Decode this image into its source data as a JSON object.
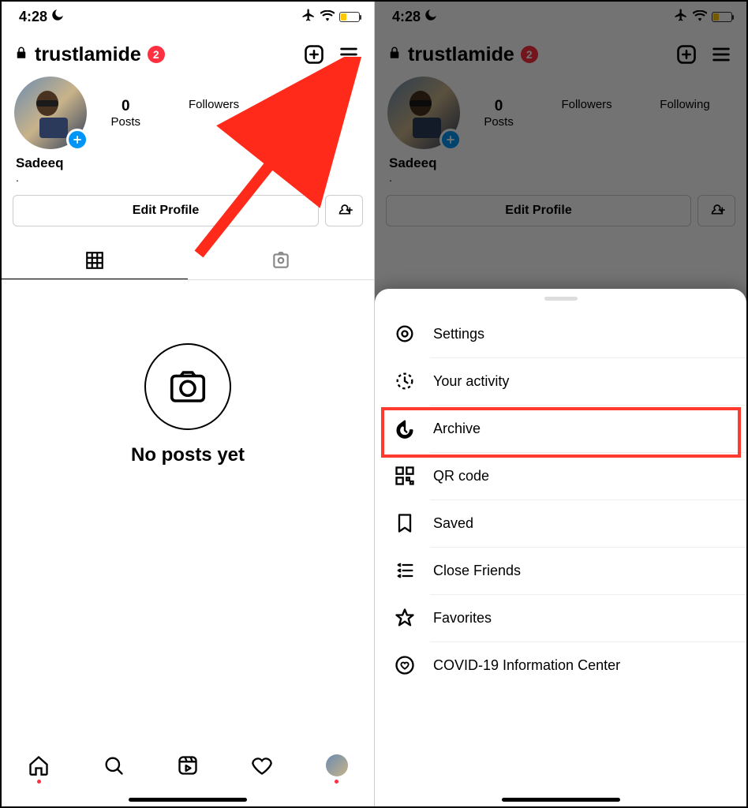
{
  "statusbar": {
    "time": "4:28",
    "battery_pct": 30,
    "battery_color_left": "#ffc800",
    "battery_color_right": "#ffc800"
  },
  "profile": {
    "username": "trustlamide",
    "notif_count": "2",
    "display_name": "Sadeeq",
    "bio": ".",
    "stats": {
      "posts": {
        "num": "0",
        "label": "Posts"
      },
      "followers": {
        "num": "",
        "label": "Followers"
      },
      "following": {
        "num": "",
        "label": "Following"
      }
    },
    "edit_label": "Edit Profile",
    "empty_message": "No posts yet"
  },
  "menu": {
    "items": [
      {
        "icon": "settings",
        "label": "Settings"
      },
      {
        "icon": "activity",
        "label": "Your activity"
      },
      {
        "icon": "archive",
        "label": "Archive"
      },
      {
        "icon": "qr",
        "label": "QR code"
      },
      {
        "icon": "saved",
        "label": "Saved"
      },
      {
        "icon": "closefriends",
        "label": "Close Friends"
      },
      {
        "icon": "favorites",
        "label": "Favorites"
      },
      {
        "icon": "covid",
        "label": "COVID-19 Information Center"
      }
    ],
    "highlighted_index": 2
  },
  "annotation": {
    "arrow_target": "hamburger menu",
    "highlight_label": "Archive"
  }
}
